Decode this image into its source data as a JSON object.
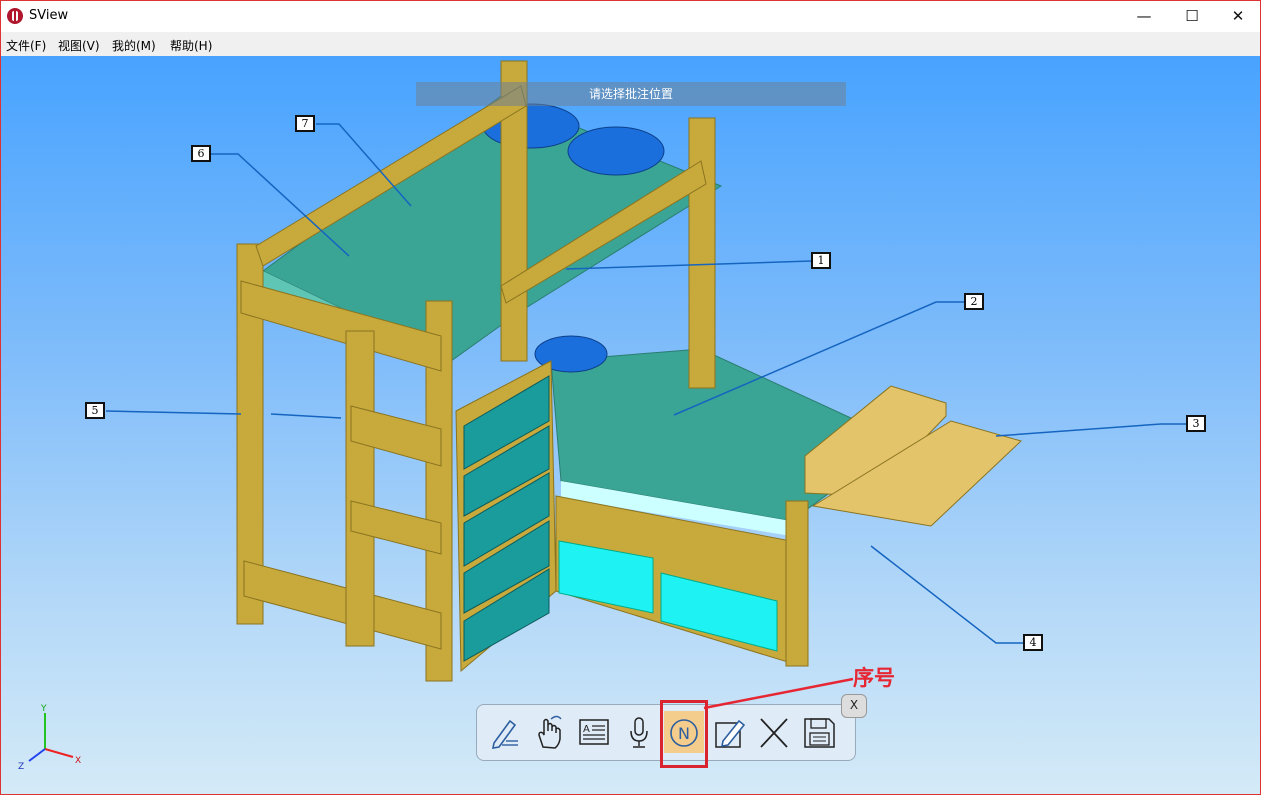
{
  "window": {
    "title": "SView"
  },
  "window_controls": {
    "minimize": "—",
    "maximize": "☐",
    "close": "✕"
  },
  "menu": [
    "文件(F)",
    "视图(V)",
    "我的(M)",
    "帮助(H)"
  ],
  "hint": "请选择批注位置",
  "callouts": [
    "1",
    "2",
    "3",
    "4",
    "5",
    "6",
    "7"
  ],
  "axes": {
    "x": "X",
    "y": "Y",
    "z": "Z"
  },
  "toolbar": {
    "tools": [
      {
        "name": "pen-annotation-icon"
      },
      {
        "name": "gesture-hand-icon"
      },
      {
        "name": "text-annotation-icon"
      },
      {
        "name": "voice-microphone-icon"
      },
      {
        "name": "number-annotation-icon",
        "active": true,
        "glyph": "N"
      },
      {
        "name": "edit-pencil-icon"
      },
      {
        "name": "delete-x-icon"
      },
      {
        "name": "save-floppy-icon"
      }
    ],
    "close_label": "X"
  },
  "annotation": {
    "label": "序号",
    "color": "#e62632"
  },
  "colors": {
    "bed_wood": "#c8a93b",
    "mattress": "#3aa594",
    "pillow": "#1a6fdc",
    "drawer": "#1a9c9c"
  }
}
